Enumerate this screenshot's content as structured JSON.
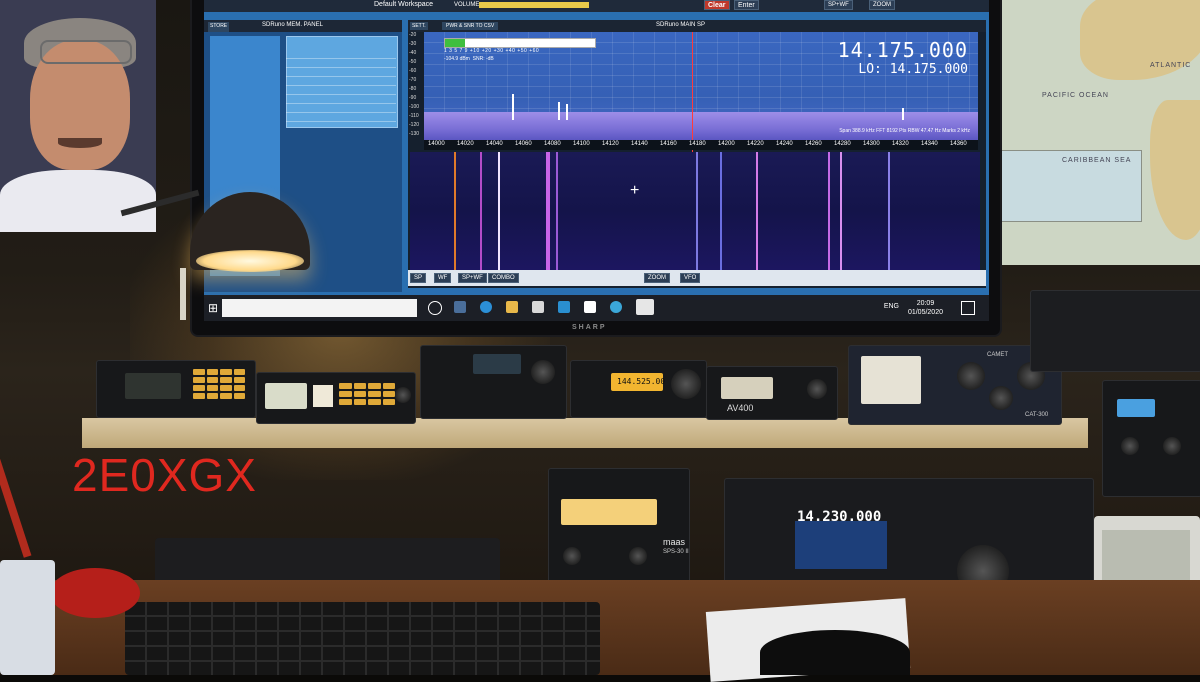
{
  "overlay": {
    "callsign": "2E0XGX"
  },
  "sdr": {
    "app": "SDRuno",
    "workspace": "Default Workspace",
    "volume_label": "VOLUME",
    "top_buttons": [
      "Clear",
      "Enter"
    ],
    "memory_panel": {
      "title": "SDRuno MEM. PANEL",
      "store_label": "STORE"
    },
    "main_sp": {
      "title": "SDRuno MAIN SP",
      "sett_label": "SETT.",
      "pwr_label": "PWR & SNR TO CSV",
      "frequency": "14.175.000",
      "lo_label": "LO:",
      "lo_frequency": "14.175.000",
      "signal_dbm": "-104.9 dBm",
      "snr": "SNR: -dB",
      "span_info": "Span 388.9 kHz  FFT 8192 Pts  RBW 47.47 Hz  Marks 2 kHz",
      "smeter_scale": "1  3  5  7  9 +10 +20 +30 +40 +50 +60",
      "y_ticks": [
        "-20",
        "-30",
        "-40",
        "-50",
        "-60",
        "-70",
        "-80",
        "-90",
        "-100",
        "-110",
        "-120",
        "-130"
      ],
      "x_ticks": [
        "14000",
        "14020",
        "14040",
        "14060",
        "14080",
        "14100",
        "14120",
        "14140",
        "14160",
        "14180",
        "14200",
        "14220",
        "14240",
        "14260",
        "14280",
        "14300",
        "14320",
        "14340",
        "14360"
      ],
      "view_buttons": [
        "SP",
        "WF",
        "SP+WF",
        "COMBO",
        "ZOOM",
        "VFO"
      ]
    },
    "colors": {
      "spectrum_bg": "#3a67c0",
      "waterfall_bg": "#1a1a55",
      "cursor": "#ff3b3b"
    }
  },
  "taskbar": {
    "lang": "ENG",
    "time": "20:09",
    "date": "01/05/2020"
  },
  "monitor_brand": "SHARP",
  "equipment": {
    "icom_freq": "144.525.00",
    "ftdx_freq": "14.230.000",
    "meter_label": "AV400",
    "psu_brand": "maas",
    "psu_model": "SPS-30 II",
    "tuner_model": "CAT-300",
    "tuner_label": "CAMET"
  },
  "map_labels": [
    "ATLANTIC",
    "PACIFIC OCEAN",
    "CARIBBEAN SEA"
  ]
}
